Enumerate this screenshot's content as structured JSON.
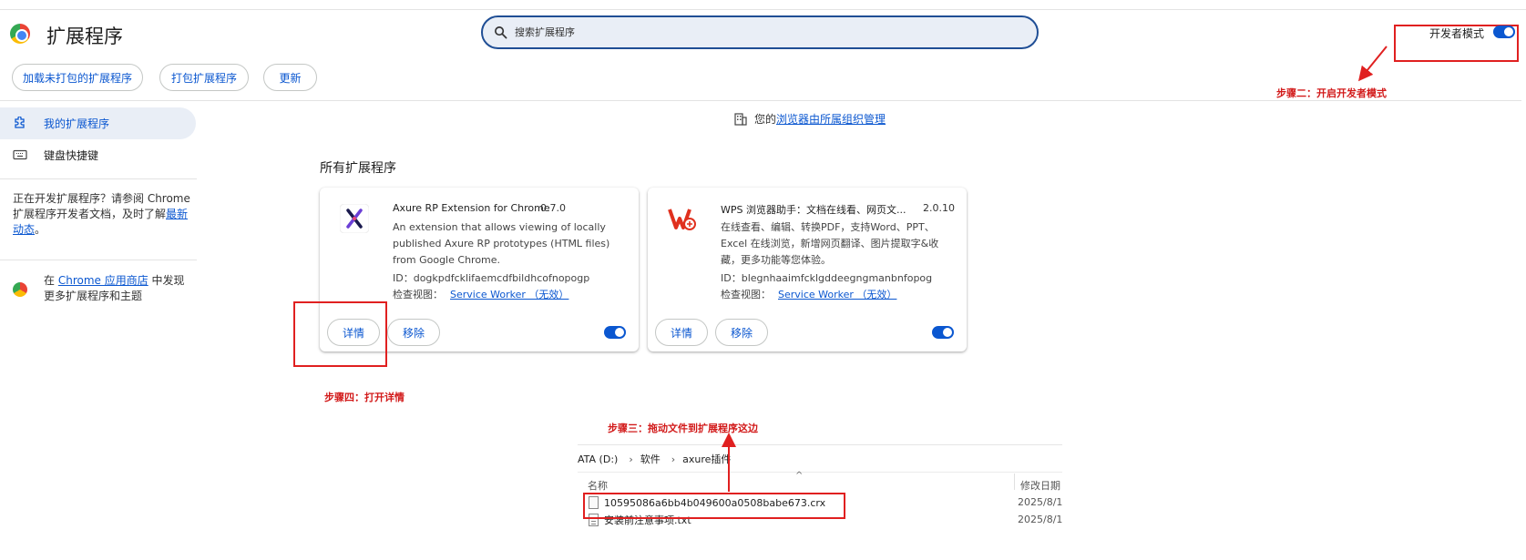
{
  "header": {
    "app_title": "扩展程序",
    "search_placeholder": "搜索扩展程序",
    "dev_mode_label": "开发者模式",
    "dev_mode_on": true
  },
  "toolbar": {
    "load_unpacked": "加载未打包的扩展程序",
    "pack": "打包扩展程序",
    "update": "更新"
  },
  "sidebar": {
    "items": [
      {
        "label": "我的扩展程序",
        "icon": "extension-icon",
        "active": true
      },
      {
        "label": "键盘快捷键",
        "icon": "keyboard-icon",
        "active": false
      }
    ],
    "dev_info_text": "正在开发扩展程序？请参阅 Chrome 扩展程序开发者文档，及时了解",
    "dev_info_link": "最新动态",
    "dev_info_end": "。",
    "store_prefix": "在 ",
    "store_link": "Chrome 应用商店",
    "store_suffix": " 中发现更多扩展程序和主题"
  },
  "managed": {
    "prefix": "您的",
    "link": "浏览器由所属组织管理"
  },
  "section_title": "所有扩展程序",
  "extensions": [
    {
      "name": "Axure RP Extension for Chrome",
      "version": "0.7.0",
      "description": "An extension that allows viewing of locally published Axure RP prototypes (HTML files) from Google Chrome.",
      "id_text": "ID：dogkpdfcklifaemcdfbildhcofnopogp",
      "inspect_label": "检查视图：",
      "inspect_link": "Service Worker （无效）",
      "details": "详情",
      "remove": "移除",
      "enabled": true
    },
    {
      "name": "WPS 浏览器助手：文档在线看、网页文...",
      "version": "2.0.10",
      "description": "在线查看、编辑、转换PDF，支持Word、PPT、Excel 在线浏览，新增网页翻译、图片提取字&收藏，更多功能等您体验。",
      "id_text": "ID：blegnhaaimfcklgddeegngmanbnfopog",
      "inspect_label": "检查视图：",
      "inspect_link": "Service Worker （无效）",
      "details": "详情",
      "remove": "移除",
      "enabled": true
    }
  ],
  "annotations": {
    "step2": "步骤二：开启开发者模式",
    "step3": "步骤三：拖动文件到扩展程序这边",
    "step4": "步骤四：打开详情",
    "color": "#e02020"
  },
  "explorer": {
    "breadcrumb": [
      "ATA (D:)",
      "软件",
      "axure插件"
    ],
    "col_name": "名称",
    "col_date": "修改日期",
    "files": [
      {
        "name": "10595086a6bb4b049600a0508babe673.crx",
        "date": "2025/8/1"
      },
      {
        "name": "安装前注意事项.txt",
        "date": "2025/8/1"
      }
    ]
  }
}
